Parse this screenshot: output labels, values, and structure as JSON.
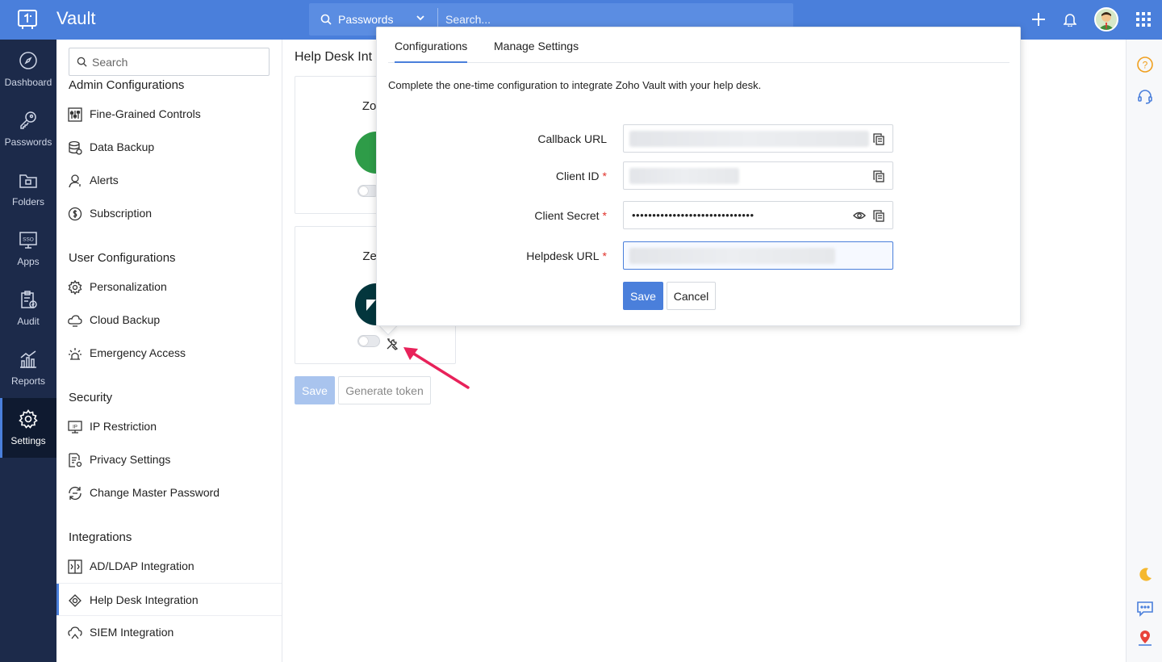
{
  "app": {
    "title": "Vault"
  },
  "topbar": {
    "search_scope": "Passwords",
    "search_placeholder": "Search..."
  },
  "leftnav": [
    {
      "label": "Dashboard",
      "icon": "compass-icon"
    },
    {
      "label": "Passwords",
      "icon": "key-icon"
    },
    {
      "label": "Folders",
      "icon": "folder-icon"
    },
    {
      "label": "Apps",
      "icon": "sso-icon"
    },
    {
      "label": "Audit",
      "icon": "clipboard-icon"
    },
    {
      "label": "Reports",
      "icon": "chart-icon"
    },
    {
      "label": "Settings",
      "icon": "gear-icon",
      "active": true
    }
  ],
  "sidebar": {
    "search_placeholder": "Search",
    "sections": [
      {
        "title": "Admin Configurations",
        "items": [
          "Fine-Grained Controls",
          "Data Backup",
          "Alerts",
          "Subscription"
        ]
      },
      {
        "title": "User Configurations",
        "items": [
          "Personalization",
          "Cloud Backup",
          "Emergency Access"
        ]
      },
      {
        "title": "Security",
        "items": [
          "IP Restriction",
          "Privacy Settings",
          "Change Master Password"
        ]
      },
      {
        "title": "Integrations",
        "items": [
          "AD/LDAP Integration",
          "Help Desk Integration",
          "SIEM Integration"
        ]
      }
    ],
    "active_item": "Help Desk Integration"
  },
  "main": {
    "page_title": "Help Desk Int",
    "cards": [
      {
        "name": "Zoho",
        "logo_color": "#2e9c48",
        "enabled": false
      },
      {
        "name": "Zenc",
        "logo_color": "#03363d",
        "enabled": false
      }
    ],
    "save_label": "Save",
    "generate_token_label": "Generate token"
  },
  "popover": {
    "tabs": [
      "Configurations",
      "Manage Settings"
    ],
    "active_tab": "Configurations",
    "description": "Complete the one-time configuration to integrate Zoho Vault with your help desk.",
    "fields": {
      "callback_url": {
        "label": "Callback URL",
        "required": false
      },
      "client_id": {
        "label": "Client ID",
        "required": true
      },
      "client_secret": {
        "label": "Client Secret",
        "required": true,
        "value": "••••••••••••••••••••••••••••••"
      },
      "helpdesk_url": {
        "label": "Helpdesk URL",
        "required": true
      }
    },
    "save_label": "Save",
    "cancel_label": "Cancel"
  },
  "colors": {
    "accent": "#4a7fdb",
    "nav_bg": "#1c2a4a",
    "annotation": "#e8225a"
  }
}
